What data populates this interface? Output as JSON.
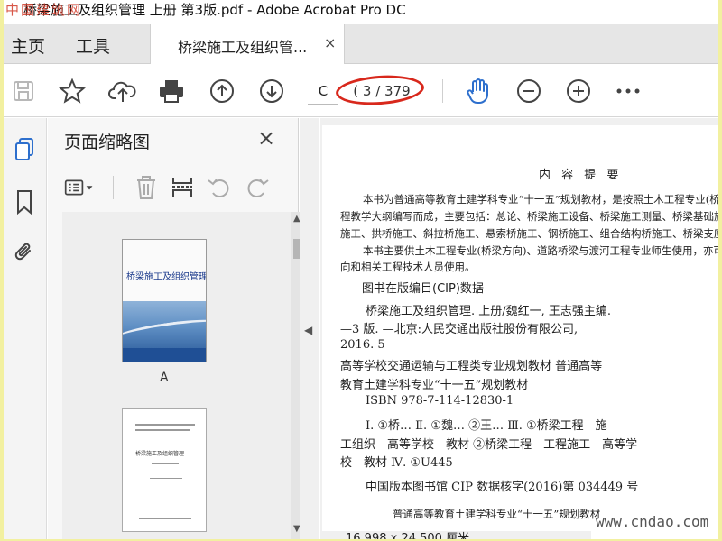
{
  "window": {
    "title": "桥梁施工及组织管理 上册 第3版.pdf - Adobe Acrobat Pro DC",
    "watermark": "中国建筑网"
  },
  "menu": {
    "home": "主页",
    "tools": "工具"
  },
  "tab": {
    "label": "桥梁施工及组织管...",
    "close": "×"
  },
  "toolbar": {
    "icons": [
      "save-icon",
      "star-icon",
      "cloud-upload-icon",
      "print-icon",
      "page-up-icon",
      "page-down-icon",
      "hand-icon",
      "zoom-out-icon",
      "zoom-in-icon",
      "more-icon"
    ],
    "current_page": "C",
    "page_total": "( 3 / 379",
    "highlight_color": "#d8281c",
    "accent": "#2d6fcd"
  },
  "panel": {
    "title": "页面缩略图",
    "close": "×",
    "thumbnails": [
      {
        "label": "A",
        "title": "桥梁施工及组织管理"
      },
      {
        "label": "",
        "title": "桥梁施工及组织管理"
      }
    ]
  },
  "document": {
    "heading": "内 容 提 要",
    "para1": [
      "本书为普通高等教育土建学科专业“十一五”规划教材，是按照土木工程专业(桥梁",
      "程教学大纲编写而成，主要包括：总论、桥梁施工设备、桥梁施工测量、桥梁基础施工、",
      "施工、拱桥施工、斜拉桥施工、悬索桥施工、钢桥施工、组合结构桥施工、桥梁支座和伸缩"
    ],
    "para2": [
      "本书主要供土木工程专业(桥梁方向)、道路桥梁与渡河工程专业师生使用，亦可供",
      "向和相关工程技术人员使用。"
    ],
    "cip_title": "图书在版编目(CIP)数据",
    "cip_lines": [
      "桥梁施工及组织管理. 上册/魏红一, 王志强主编.",
      "—3 版. —北京:人民交通出版社股份有限公司,",
      "2016. 5",
      "  高等学校交通运输与工程类专业规划教材   普通高等",
      "教育土建学科专业“十一五”规划教材",
      "ISBN 978-7-114-12830-1",
      "Ⅰ. ①桥…   Ⅱ. ①魏… ②王…   Ⅲ. ①桥梁工程—施",
      "工组织—高等学校—教材 ②桥梁工程—工程施工—高等学",
      "校—教材   Ⅳ. ①U445",
      "中国版本图书馆 CIP 数据核字(2016)第 034449 号",
      "普通高等教育土建学科专业“十一五”规划教材"
    ],
    "page_size": "16.998 x 24.500 厘米"
  },
  "site_watermark": "www.cndao.com"
}
